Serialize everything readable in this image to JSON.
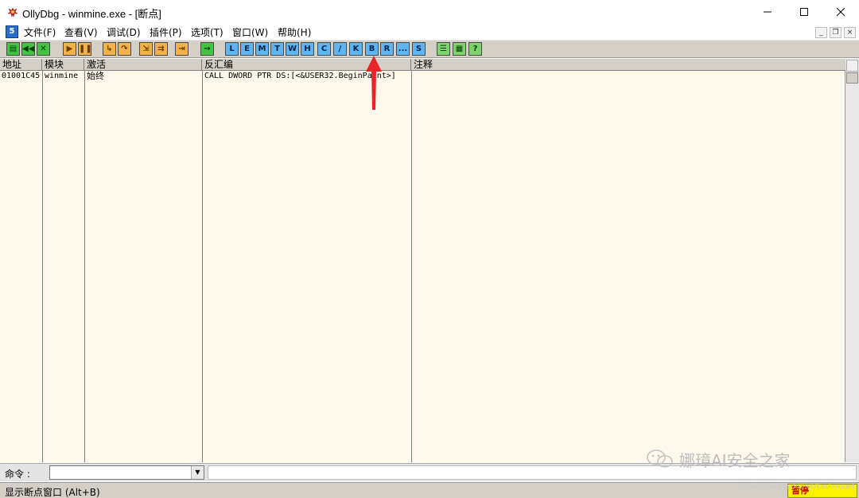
{
  "window": {
    "title": "OllyDbg - winmine.exe - [断点]"
  },
  "menu": {
    "icon_label": "5",
    "items": [
      "文件(F)",
      "查看(V)",
      "调试(D)",
      "插件(P)",
      "选项(T)",
      "窗口(W)",
      "帮助(H)"
    ]
  },
  "toolbar": {
    "buttons": [
      "open",
      "restart",
      "close",
      "run",
      "pause",
      "step-into",
      "step-over",
      "trace-into",
      "trace-over",
      "execute-till-return",
      "goto",
      "L",
      "E",
      "M",
      "T",
      "W",
      "H",
      "C",
      "/",
      "K",
      "B",
      "R",
      "...",
      "S",
      "list",
      "grid",
      "help"
    ],
    "letter_buttons": [
      "L",
      "E",
      "M",
      "T",
      "W",
      "H",
      "C",
      "/",
      "K",
      "B",
      "R",
      "...",
      "S"
    ],
    "help_label": "?"
  },
  "breakpoints": {
    "columns": [
      "地址",
      "模块",
      "激活",
      "反汇编",
      "注释"
    ],
    "rows": [
      {
        "address": "01001C45",
        "module": "winmine",
        "active": "始终",
        "disasm": "CALL DWORD PTR DS:[<&USER32.BeginPaint>]",
        "comment": ""
      }
    ]
  },
  "command": {
    "label": "命令 :",
    "value": ""
  },
  "status": {
    "text": "显示断点窗口 (Alt+B)",
    "state": "暂停"
  },
  "watermark": {
    "text": "娜璋AI安全之家",
    "url": "https://blog.csdn.net/Eastmount"
  },
  "colors": {
    "table_bg": "#fef9eb",
    "toolbar_bg": "#d4d0c8",
    "status_pause_bg": "#fff200",
    "arrow": "#e8262a"
  }
}
